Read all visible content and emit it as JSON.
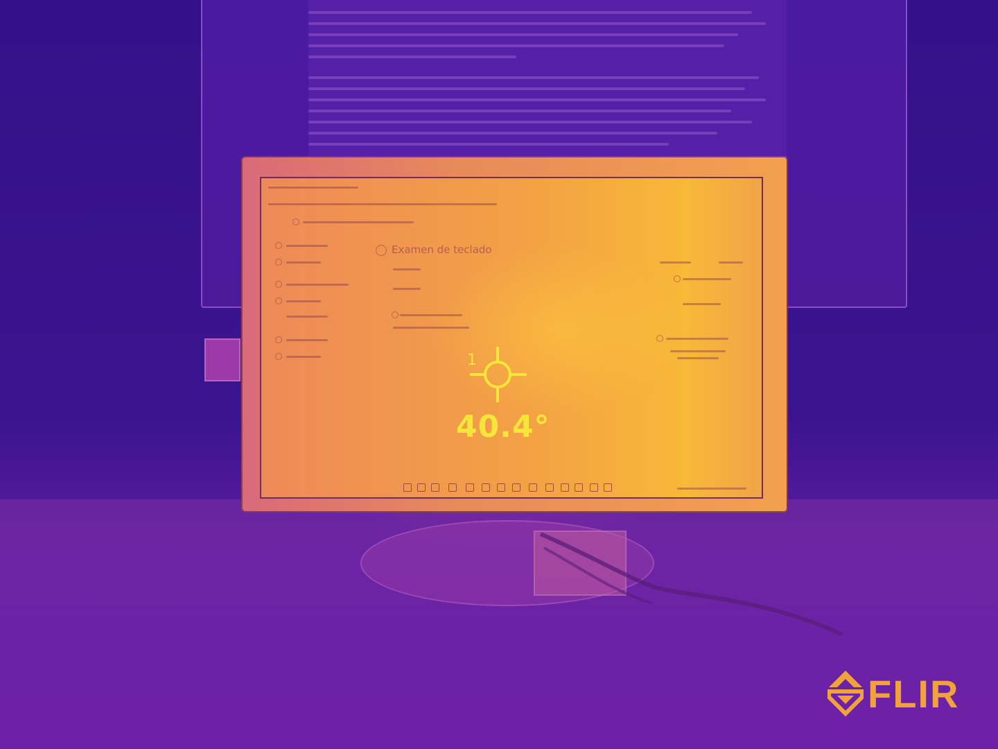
{
  "image": {
    "kind": "thermal camera photo",
    "subject": "computer monitor on a desk",
    "palette": "iron / purple-to-yellow",
    "colors": {
      "cold": "#3a1490",
      "warm": "#e88a5a",
      "hot": "#f8b838",
      "overlay": "#f7e63a",
      "logo": "#f2a23a"
    }
  },
  "measurement": {
    "spot_index": "1",
    "temperature": "40.4°",
    "marker_icon": "crosshair-icon"
  },
  "screen_ui": {
    "heading": "Examen de teclado"
  },
  "branding": {
    "logo_text": "FLIR",
    "logo_icon": "flir-diamond-icon"
  }
}
